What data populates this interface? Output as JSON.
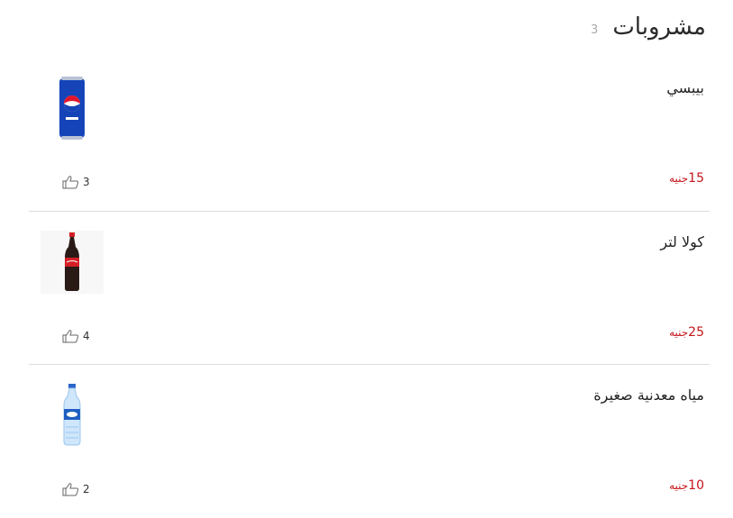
{
  "section": {
    "title": "مشروبات",
    "count": "3"
  },
  "items": [
    {
      "name": "بيبسي",
      "price": "15",
      "currency": "جنيه",
      "likes": "3",
      "image_icon": "pepsi-can-icon"
    },
    {
      "name": "كولا لتر",
      "price": "25",
      "currency": "جنيه",
      "likes": "4",
      "image_icon": "cola-bottle-icon"
    },
    {
      "name": "مياه معدنية صغيرة",
      "price": "10",
      "currency": "جنيه",
      "likes": "2",
      "image_icon": "water-bottle-icon"
    }
  ],
  "colors": {
    "price": "#c4161c",
    "divider": "#dddddd",
    "count": "#aaaaaa"
  }
}
